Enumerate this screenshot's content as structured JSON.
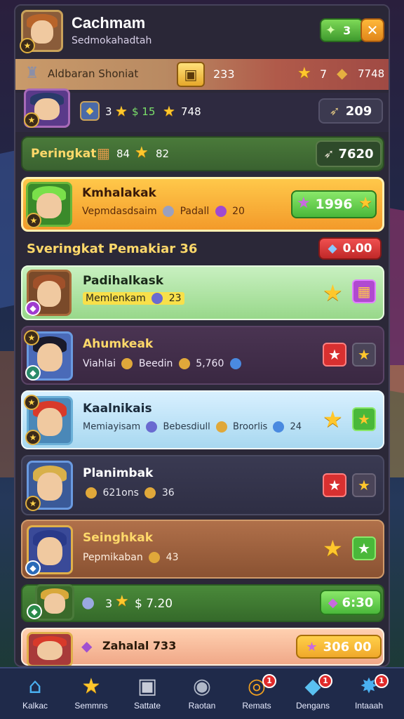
{
  "header": {
    "title": "Cachmam",
    "subtitle": "Sedmokahadtah",
    "currency_value": "3",
    "close_icon": "close-icon"
  },
  "infobar": {
    "label": "Aldbaran Shoniat",
    "count": "233",
    "stars": "7",
    "resource": "7748"
  },
  "top_row": {
    "stars": "3",
    "cash": "$ 15",
    "stat": "748",
    "resource": "209"
  },
  "peringkat_bar": {
    "label": "Peringkat",
    "count": "84",
    "stars": "82",
    "value": "7620"
  },
  "featured": {
    "name": "Kmhalakak",
    "desc": "Vepmdasdsaim",
    "stat1": "Padall",
    "stat2": "20",
    "score": "1996"
  },
  "section": {
    "title": "Sveringkat Pemakiar 36",
    "value": "0.00"
  },
  "rows": [
    {
      "name": "Padihalkask",
      "desc": "Memlenkam",
      "stat": "23"
    },
    {
      "name": "Ahumkeak",
      "desc": "Viahlai",
      "stat1": "Beedin",
      "stat2": "5,760"
    },
    {
      "name": "Kaalnikais",
      "desc": "Memiayisam",
      "stat1": "Bebesdiull",
      "stat2": "Broorlis",
      "stat3": "24"
    },
    {
      "name": "Planimbak",
      "stat1": "621ons",
      "stat2": "36"
    },
    {
      "name": "Seinghkak",
      "desc": "Pepmikaban",
      "stat": "43"
    }
  ],
  "green_row": {
    "stars": "3",
    "cash": "$ 7.20",
    "value": "6:30"
  },
  "last_row": {
    "name": "Zahalal 733",
    "value": "306 00"
  },
  "nav": [
    {
      "label": "Kalkac",
      "icon": "home-icon",
      "badge": ""
    },
    {
      "label": "Semmns",
      "icon": "star-icon",
      "badge": ""
    },
    {
      "label": "Sattate",
      "icon": "square-icon",
      "badge": ""
    },
    {
      "label": "Raotan",
      "icon": "compass-icon",
      "badge": ""
    },
    {
      "label": "Remats",
      "icon": "target-icon",
      "badge": "1"
    },
    {
      "label": "Dengans",
      "icon": "gem-icon",
      "badge": "1"
    },
    {
      "label": "Intaaah",
      "icon": "burst-icon",
      "badge": "1"
    }
  ]
}
